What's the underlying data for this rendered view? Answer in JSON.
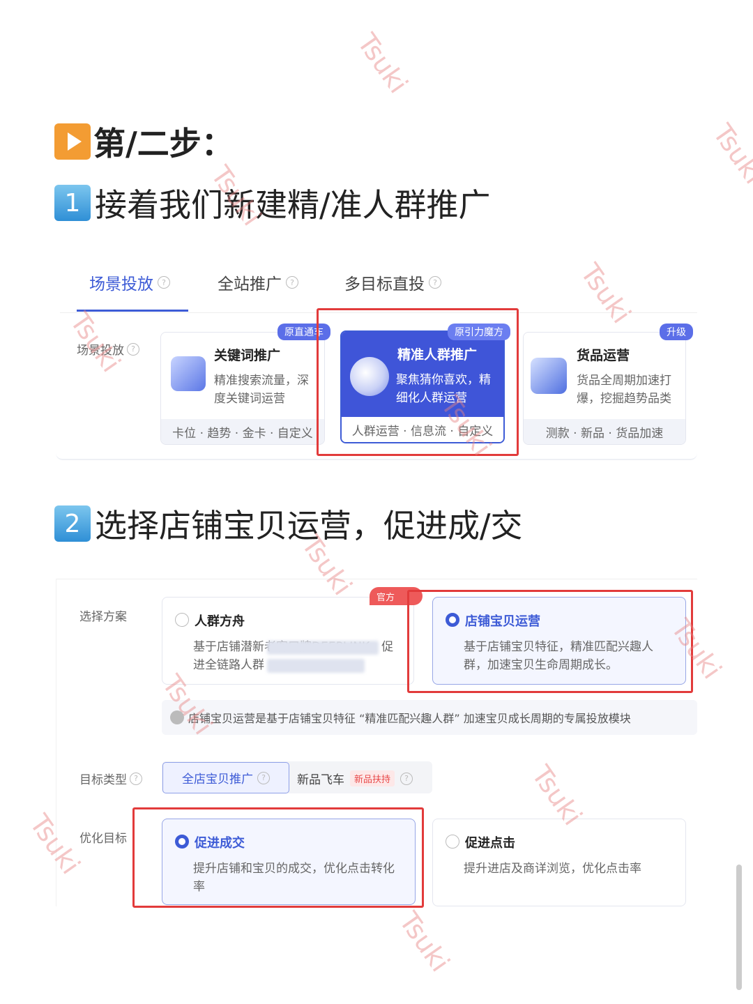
{
  "step_heading": "第/二步：",
  "sub1": {
    "num": "1",
    "text": "接着我们新建精/准人群推广"
  },
  "sub2": {
    "num": "2",
    "text": "选择店铺宝贝运营，促进成/交"
  },
  "tabs": [
    {
      "label": "场景投放"
    },
    {
      "label": "全站推广"
    },
    {
      "label": "多目标直投"
    }
  ],
  "scene_label": "场景投放",
  "cards": [
    {
      "badge": "原直通车",
      "title": "关键词推广",
      "desc1": "精准搜索流量，深",
      "desc2": "度关键词运营",
      "footer": "卡位 · 趋势 · 金卡 · 自定义"
    },
    {
      "badge": "原引力魔方",
      "title": "精准人群推广",
      "desc1": "聚焦猜你喜欢，精",
      "desc2": "细化人群运营",
      "footer": "人群运营 · 信息流 · 自定义"
    },
    {
      "badge": "升级",
      "title": "货品运营",
      "desc1": "货品全周期加速打",
      "desc2": "爆，挖掘趋势品类",
      "footer": "测款 · 新品 · 货品加速"
    }
  ],
  "plan": {
    "label": "选择方案",
    "options": [
      {
        "title": "人群方舟",
        "desc1": "基于店铺潜新老客口牌DEEPLINK，促",
        "desc2": "进全链路人群"
      },
      {
        "title": "店铺宝贝运营",
        "desc1": "基于店铺宝贝特征，精准匹配兴趣人",
        "desc2": "群，加速宝贝生命周期成长。"
      }
    ],
    "tag": "官方",
    "note": "店铺宝贝运营是基于店铺宝贝特征 “精准匹配兴趣人群” 加速宝贝成长周期的专属投放模块"
  },
  "target": {
    "label": "目标类型",
    "options": [
      "全店宝贝推广",
      "新品飞车"
    ],
    "badge": "新品扶持"
  },
  "optimize": {
    "label": "优化目标",
    "options": [
      {
        "title": "促进成交",
        "desc1": "提升店铺和宝贝的成交，优化点击转化",
        "desc2": "率"
      },
      {
        "title": "促进点击",
        "desc1": "提升进店及商详浏览，优化点击率"
      }
    ]
  },
  "watermark": "Tsuki",
  "colors": {
    "accent": "#3d5bd6",
    "highlight": "#e23b3b",
    "step_icon": "#f39c33"
  }
}
